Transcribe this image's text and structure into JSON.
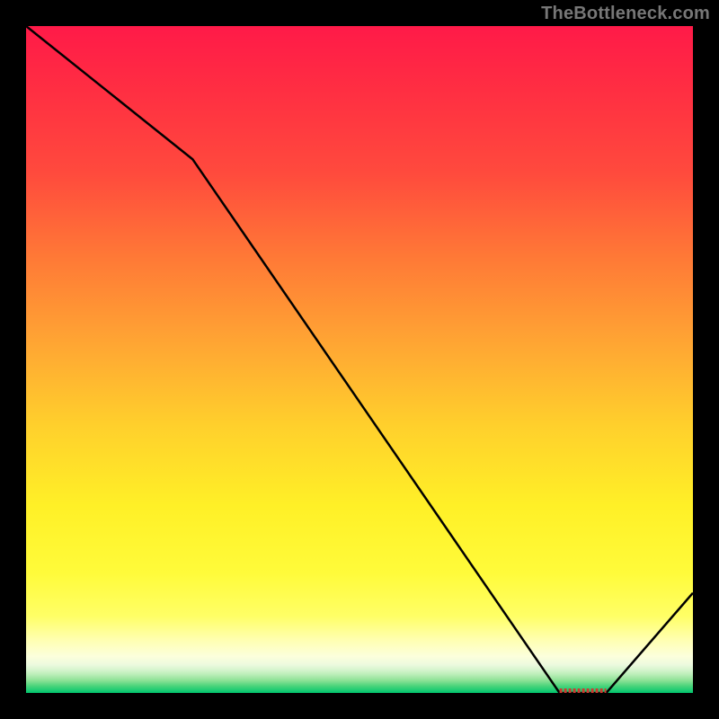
{
  "attribution": "TheBottleneck.com",
  "chart_data": {
    "type": "line",
    "title": "",
    "xlabel": "",
    "ylabel": "",
    "xlim": [
      0,
      100
    ],
    "ylim": [
      0,
      100
    ],
    "grid": false,
    "legend": "none",
    "series": [
      {
        "name": "curve",
        "x": [
          0,
          25,
          80,
          87,
          100
        ],
        "y": [
          100,
          80,
          0,
          0,
          15
        ]
      }
    ],
    "annotations": [
      {
        "type": "flat-segment",
        "x_start": 80,
        "x_end": 87,
        "y": 0
      }
    ],
    "gradient_stops": [
      {
        "offset": 0.0,
        "color": "#ff1a48"
      },
      {
        "offset": 0.1,
        "color": "#ff2f42"
      },
      {
        "offset": 0.22,
        "color": "#ff4a3d"
      },
      {
        "offset": 0.35,
        "color": "#ff7a36"
      },
      {
        "offset": 0.48,
        "color": "#ffa733"
      },
      {
        "offset": 0.6,
        "color": "#ffd02c"
      },
      {
        "offset": 0.72,
        "color": "#fff027"
      },
      {
        "offset": 0.82,
        "color": "#fffb3a"
      },
      {
        "offset": 0.885,
        "color": "#ffff66"
      },
      {
        "offset": 0.92,
        "color": "#ffffb0"
      },
      {
        "offset": 0.945,
        "color": "#fcffdc"
      },
      {
        "offset": 0.958,
        "color": "#ecfade"
      },
      {
        "offset": 0.966,
        "color": "#d4f4cc"
      },
      {
        "offset": 0.973,
        "color": "#b8edb6"
      },
      {
        "offset": 0.981,
        "color": "#8ee297"
      },
      {
        "offset": 0.99,
        "color": "#48d37a"
      },
      {
        "offset": 1.0,
        "color": "#00c66e"
      }
    ],
    "zero_band_color": "#cc3a30"
  }
}
